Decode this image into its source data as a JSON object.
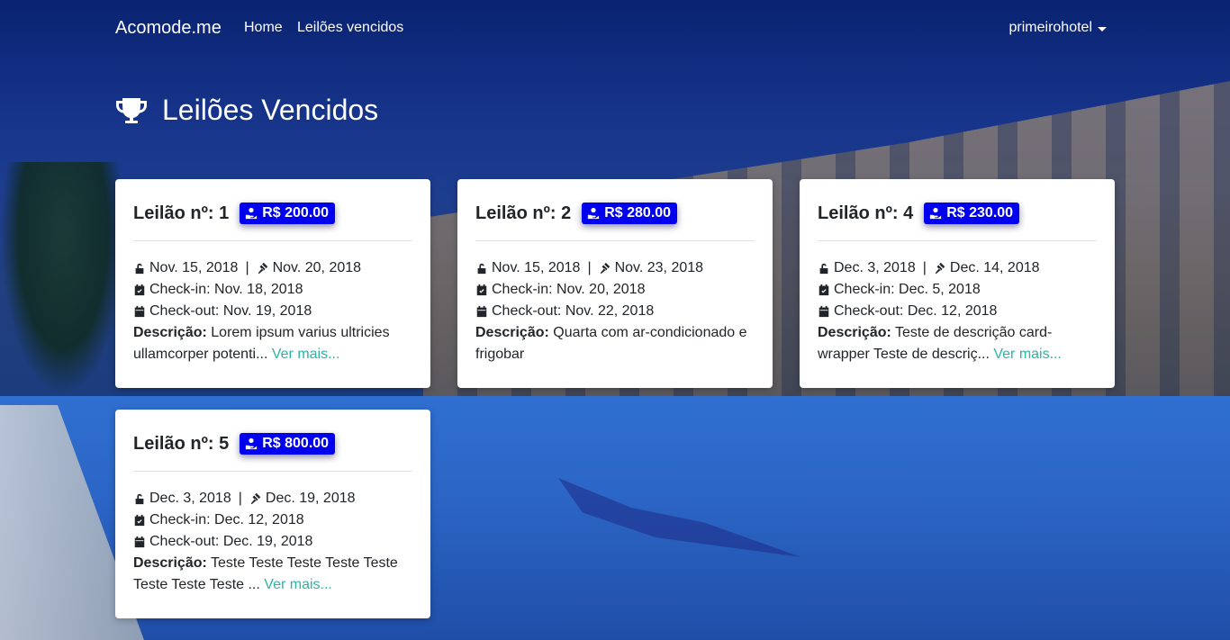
{
  "navbar": {
    "brand": "Acomode.me",
    "links": [
      "Home",
      "Leilões vencidos"
    ],
    "user": "primeirohotel"
  },
  "page": {
    "title": "Leilões Vencidos",
    "title_icon": "trophy-icon"
  },
  "colors": {
    "badge_bg": "#0000ee",
    "link": "#2bb3a6"
  },
  "cards": [
    {
      "title": "Leilão nº: 1",
      "price": "R$ 200.00",
      "open_date": "Nov. 15, 2018",
      "close_date": "Nov. 20, 2018",
      "checkin": "Check-in: Nov. 18, 2018",
      "checkout": "Check-out: Nov. 19, 2018",
      "desc_label": "Descrição:",
      "desc_text": "Lorem ipsum varius ultricies ullamcorper potenti...",
      "more": "Ver mais..."
    },
    {
      "title": "Leilão nº: 2",
      "price": "R$ 280.00",
      "open_date": "Nov. 15, 2018",
      "close_date": "Nov. 23, 2018",
      "checkin": "Check-in: Nov. 20, 2018",
      "checkout": "Check-out: Nov. 22, 2018",
      "desc_label": "Descrição:",
      "desc_text": "Quarta com ar-condicionado e frigobar",
      "more": ""
    },
    {
      "title": "Leilão nº: 4",
      "price": "R$ 230.00",
      "open_date": "Dec. 3, 2018",
      "close_date": "Dec. 14, 2018",
      "checkin": "Check-in: Dec. 5, 2018",
      "checkout": "Check-out: Dec. 12, 2018",
      "desc_label": "Descrição:",
      "desc_text": "Teste de descrição card-wrapper Teste de descriç...",
      "more": "Ver mais..."
    },
    {
      "title": "Leilão nº: 5",
      "price": "R$ 800.00",
      "open_date": "Dec. 3, 2018",
      "close_date": "Dec. 19, 2018",
      "checkin": "Check-in: Dec. 12, 2018",
      "checkout": "Check-out: Dec. 19, 2018",
      "desc_label": "Descrição:",
      "desc_text": "Teste Teste Teste Teste Teste Teste Teste Teste ...",
      "more": "Ver mais..."
    }
  ]
}
